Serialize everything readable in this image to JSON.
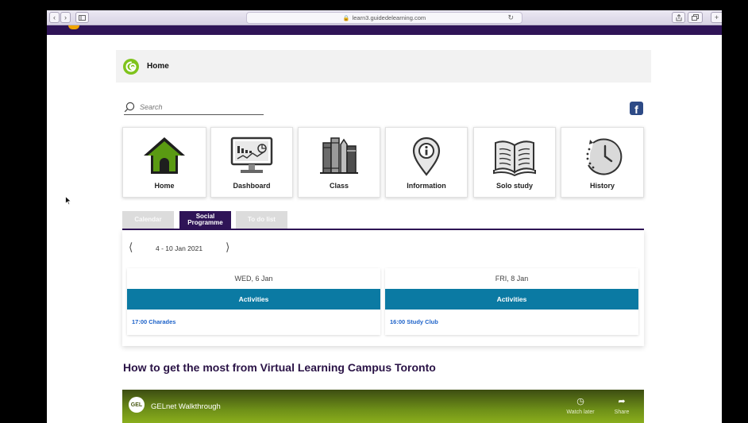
{
  "browser": {
    "url": "learn3.guidedelearning.com"
  },
  "header": {
    "title": "Home"
  },
  "search": {
    "placeholder": "Search"
  },
  "tiles": [
    {
      "label": "Home",
      "icon": "house-icon"
    },
    {
      "label": "Dashboard",
      "icon": "monitor-chart-icon"
    },
    {
      "label": "Class",
      "icon": "books-icon"
    },
    {
      "label": "Information",
      "icon": "info-pin-icon"
    },
    {
      "label": "Solo study",
      "icon": "open-book-icon"
    },
    {
      "label": "History",
      "icon": "clock-history-icon"
    }
  ],
  "tabs": [
    {
      "label": "Calendar",
      "active": false
    },
    {
      "label": "Social Programme",
      "active": true
    },
    {
      "label": "To do list",
      "active": false
    }
  ],
  "calendar": {
    "week_range": "4 - 10 Jan 2021",
    "days": [
      {
        "date": "WED, 6 Jan",
        "bar_label": "Activities",
        "event": "17:00 Charades"
      },
      {
        "date": "FRI, 8 Jan",
        "bar_label": "Activities",
        "event": "16:00 Study Club"
      }
    ]
  },
  "section_heading": "How to get the most from Virtual Learning Campus Toronto",
  "video": {
    "badge": "GEL",
    "title": "GELnet Walkthrough",
    "watch_later": "Watch later",
    "share": "Share"
  },
  "colors": {
    "brand_purple": "#2f1457",
    "activities_blue": "#0b7aa3",
    "house_green": "#5a9a12",
    "event_blue": "#1d62c9"
  }
}
